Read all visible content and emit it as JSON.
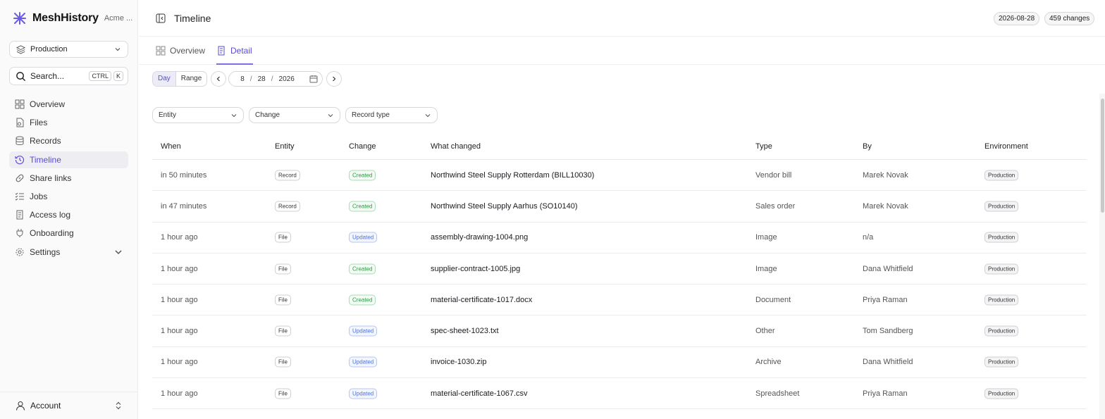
{
  "app": {
    "name": "MeshHistory",
    "org": "Acme ..."
  },
  "env_select": {
    "value": "Production"
  },
  "search": {
    "placeholder": "Search...",
    "kbd1": "CTRL",
    "kbd2": "K"
  },
  "nav": [
    {
      "label": "Overview",
      "icon": "grid-icon"
    },
    {
      "label": "Files",
      "icon": "file-icon"
    },
    {
      "label": "Records",
      "icon": "database-icon"
    },
    {
      "label": "Timeline",
      "icon": "history-icon",
      "active": true
    },
    {
      "label": "Share links",
      "icon": "link-icon"
    },
    {
      "label": "Jobs",
      "icon": "list-check-icon"
    },
    {
      "label": "Access log",
      "icon": "scroll-icon"
    },
    {
      "label": "Onboarding",
      "icon": "plug-icon"
    },
    {
      "label": "Settings",
      "icon": "gear-icon"
    }
  ],
  "account": {
    "label": "Account"
  },
  "header": {
    "title": "Timeline",
    "date_pill": "2026-08-28",
    "changes_pill": "459 changes"
  },
  "tabs": [
    {
      "label": "Overview"
    },
    {
      "label": "Detail"
    }
  ],
  "datebar": {
    "day": "Day",
    "range": "Range",
    "month": "8",
    "day_num": "28",
    "year": "2026",
    "sep": "/"
  },
  "filters": {
    "entity": "Entity",
    "change": "Change",
    "record_type": "Record type"
  },
  "table": {
    "columns": [
      "When",
      "Entity",
      "Change",
      "What changed",
      "Type",
      "By",
      "Environment"
    ],
    "rows": [
      {
        "when": "in 50 minutes",
        "entity": "Record",
        "change": "Created",
        "what": "Northwind Steel Supply Rotterdam (BILL10030)",
        "type": "Vendor bill",
        "by": "Marek Novak",
        "env": "Production"
      },
      {
        "when": "in 47 minutes",
        "entity": "Record",
        "change": "Created",
        "what": "Northwind Steel Supply Aarhus (SO10140)",
        "type": "Sales order",
        "by": "Marek Novak",
        "env": "Production"
      },
      {
        "when": "1 hour ago",
        "entity": "File",
        "change": "Updated",
        "what": "assembly-drawing-1004.png",
        "type": "Image",
        "by": "n/a",
        "env": "Production"
      },
      {
        "when": "1 hour ago",
        "entity": "File",
        "change": "Created",
        "what": "supplier-contract-1005.jpg",
        "type": "Image",
        "by": "Dana Whitfield",
        "env": "Production"
      },
      {
        "when": "1 hour ago",
        "entity": "File",
        "change": "Created",
        "what": "material-certificate-1017.docx",
        "type": "Document",
        "by": "Priya Raman",
        "env": "Production"
      },
      {
        "when": "1 hour ago",
        "entity": "File",
        "change": "Updated",
        "what": "spec-sheet-1023.txt",
        "type": "Other",
        "by": "Tom Sandberg",
        "env": "Production"
      },
      {
        "when": "1 hour ago",
        "entity": "File",
        "change": "Updated",
        "what": "invoice-1030.zip",
        "type": "Archive",
        "by": "Dana Whitfield",
        "env": "Production"
      },
      {
        "when": "1 hour ago",
        "entity": "File",
        "change": "Updated",
        "what": "material-certificate-1067.csv",
        "type": "Spreadsheet",
        "by": "Priya Raman",
        "env": "Production"
      }
    ]
  },
  "colors": {
    "accent": "#5b4bd4",
    "created": "#2e9a46",
    "updated": "#4f73d9"
  }
}
